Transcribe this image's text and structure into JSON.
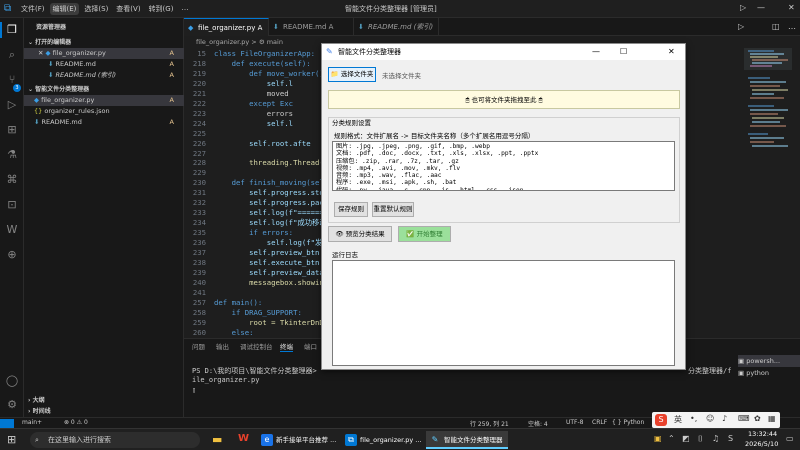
{
  "vscode": {
    "menu": [
      "文件(F)",
      "编辑(E)",
      "选择(S)",
      "查看(V)",
      "转到(G)",
      "…"
    ],
    "window_title": "智能文件分类整理器 [管理员]",
    "sidebar": {
      "header": "资源管理器",
      "open_editors_title": "打开的编辑器",
      "open_editors": [
        {
          "name": "file_organizer.py",
          "mark": "A"
        },
        {
          "name": "README.md",
          "mark": "A"
        },
        {
          "name": "README.md (索引)",
          "mark": "A"
        }
      ],
      "project_title": "智能文件分类整理器",
      "files": [
        {
          "name": "file_organizer.py",
          "mark": "A"
        },
        {
          "name": "organizer_rules.json",
          "mark": ""
        },
        {
          "name": "README.md",
          "mark": "A"
        }
      ],
      "outline": "大纲",
      "timeline": "时间线"
    },
    "tabs": [
      {
        "label": "file_organizer.py A",
        "active": true
      },
      {
        "label": "README.md A",
        "active": false
      },
      {
        "label": "README.md (索引)",
        "active": false
      }
    ],
    "breadcrumb": "file_organizer.py > ⚙ main",
    "code_lines": [
      {
        "n": "15",
        "t": "class FileOrganizerApp:"
      },
      {
        "n": "218",
        "t": "    def execute(self):"
      },
      {
        "n": "219",
        "t": "        def move_worker():"
      },
      {
        "n": "220",
        "t": "            self.l"
      },
      {
        "n": "221",
        "t": "            moved"
      },
      {
        "n": "222",
        "t": "        except Exc"
      },
      {
        "n": "223",
        "t": "            errors"
      },
      {
        "n": "224",
        "t": "            self.l"
      },
      {
        "n": "225",
        "t": ""
      },
      {
        "n": "226",
        "t": "        self.root.afte"
      },
      {
        "n": "227",
        "t": ""
      },
      {
        "n": "228",
        "t": "        threading.Thread(t"
      },
      {
        "n": "229",
        "t": ""
      },
      {
        "n": "230",
        "t": "    def finish_moving(self"
      },
      {
        "n": "231",
        "t": "        self.progress.stop"
      },
      {
        "n": "232",
        "t": "        self.progress.pack"
      },
      {
        "n": "233",
        "t": "        self.log(f\"======"
      },
      {
        "n": "234",
        "t": "        self.log(f\"成功移动"
      },
      {
        "n": "235",
        "t": "        if errors:"
      },
      {
        "n": "236",
        "t": "            self.log(f\"发生"
      },
      {
        "n": "237",
        "t": "        self.preview_btn.c"
      },
      {
        "n": "238",
        "t": "        self.execute_btn.c"
      },
      {
        "n": "239",
        "t": "        self.preview_data"
      },
      {
        "n": "240",
        "t": "        messagebox.showinf"
      },
      {
        "n": "241",
        "t": ""
      },
      {
        "n": "257",
        "t": "def main():"
      },
      {
        "n": "258",
        "t": "    if DRAG_SUPPORT:"
      },
      {
        "n": "259",
        "t": "        root = TkinterDnD."
      },
      {
        "n": "260",
        "t": "    else:"
      }
    ],
    "panel_tabs": [
      "问题",
      "输出",
      "调试控制台",
      "终端",
      "端口"
    ],
    "terminal_lines": [
      "PS D:\\我的项目\\智能文件分类整理器> ",
      "ile_organizer.py"
    ],
    "terminal_tail": "分类整理器/f",
    "terminal_list": [
      "powersh...",
      "python"
    ],
    "status": {
      "branch": "main+",
      "errors": "⊗ 0 ⚠ 0",
      "position": "行 259, 列 21",
      "spaces": "空格: 4",
      "encoding": "UTF-8",
      "eol": "CRLF",
      "language": "{ } Python"
    }
  },
  "tk_window": {
    "title": "智能文件分类整理器",
    "select_folder_button": "📁 选择文件夹",
    "no_folder_label": "未选择文件夹",
    "drop_hint": "🖱 也可将文件夹拖拽至此 🖱",
    "rules_group_title": "分类规则设置",
    "rules_format": "规则格式：文件扩展名 -> 目标文件夹名称（多个扩展名用逗号分隔）",
    "rules_text": "图片: .jpg, .jpeg, .png, .gif, .bmp, .webp\n文档: .pdf, .doc, .docx, .txt, .xls, .xlsx, .ppt, .pptx\n压缩包: .zip, .rar, .7z, .tar, .gz\n视频: .mp4, .avi, .mov, .mkv, .flv\n音频: .mp3, .wav, .flac, .aac\n程序: .exe, .msi, .apk, .sh, .bat\n代码: .py, .java, .c, .cpp, .js, .html, .css, .json",
    "save_rules_button": "保存规则",
    "reset_rules_button": "重置默认规则",
    "preview_button": "👁 预览分类结果",
    "start_button": "✅ 开始整理",
    "log_title": "运行日志"
  },
  "taskbar": {
    "search_placeholder": "在这里输入进行搜索",
    "apps": [
      {
        "label": "新手接单平台推荐 ...",
        "active": false
      },
      {
        "label": "file_organizer.py ...",
        "active": false
      },
      {
        "label": "智能文件分类整理器",
        "active": true
      }
    ],
    "time": "13:32:44",
    "date": "2026/5/10",
    "ime": "英"
  }
}
